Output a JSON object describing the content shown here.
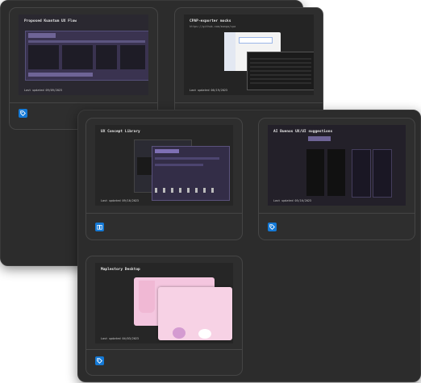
{
  "colors": {
    "window_bg": "#2c2c2c",
    "card_bg": "#2e2e2e",
    "badge_blue": "#1479d6",
    "purple_panel": "#3a3350",
    "pink_card": "#f4c6df"
  },
  "back_window": {
    "cards": [
      {
        "title": "Proposed Kuantum UX Flow",
        "updated": "Last updated 09/09/2023",
        "icon": "tag-icon"
      },
      {
        "title": "CPAP-exporter mocks",
        "subtitle": "https://github.com/manga/cpa",
        "updated": "Last updated 06/19/2023",
        "icon": "tag-icon"
      }
    ]
  },
  "front_window": {
    "cards": [
      {
        "title": "UX Concept Library",
        "updated": "Last updated 09/16/2023",
        "icon": "book-icon"
      },
      {
        "title": "AI Buenos UX/UI suggestions",
        "updated": "Last updated 05/16/2023",
        "icon": "tag-icon"
      },
      {
        "title": "Maplestory Desktop",
        "updated": "Last updated 04/03/2023",
        "icon": "tag-icon"
      }
    ]
  }
}
